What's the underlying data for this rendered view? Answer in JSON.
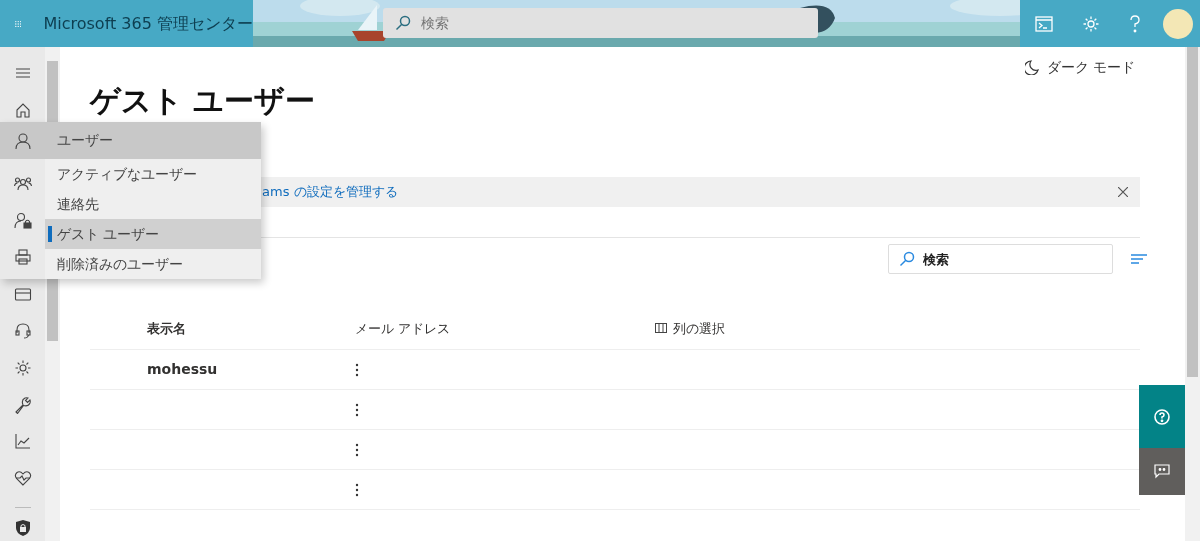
{
  "header": {
    "title": "Microsoft 365 管理センター",
    "search_placeholder": "検索"
  },
  "flyout": {
    "title": "ユーザー",
    "expanded": true,
    "items": [
      {
        "label": "アクティブなユーザー",
        "selected": false
      },
      {
        "label": "連絡先",
        "selected": false
      },
      {
        "label": "ゲスト ユーザー",
        "selected": true
      },
      {
        "label": "削除済みのユーザー",
        "selected": false
      }
    ]
  },
  "dark_mode": "ダーク モード",
  "page_title": "ゲスト ユーザー",
  "banner": {
    "link": "ams の設定を管理する"
  },
  "search": {
    "placeholder": "検索"
  },
  "table": {
    "columns": [
      "表示名",
      "メール アドレス"
    ],
    "column_picker": "列の選択",
    "rows": [
      {
        "display_name": "mohessu"
      },
      {},
      {},
      {}
    ]
  }
}
